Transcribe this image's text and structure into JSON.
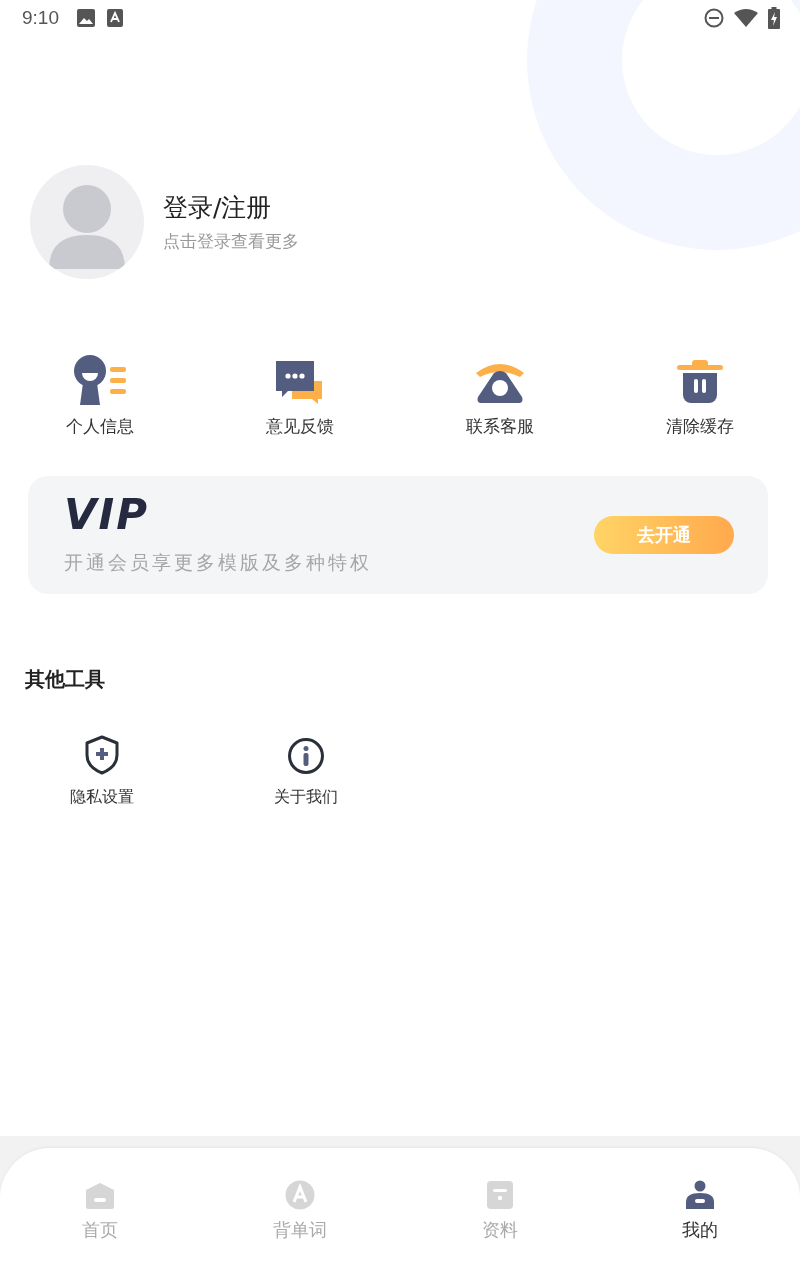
{
  "status_bar": {
    "time": "9:10"
  },
  "profile": {
    "title": "登录/注册",
    "subtitle": "点击登录查看更多"
  },
  "quick_actions": [
    {
      "kind": "profile",
      "label": "个人信息"
    },
    {
      "kind": "feedback",
      "label": "意见反馈"
    },
    {
      "kind": "phone",
      "label": "联系客服"
    },
    {
      "kind": "trash",
      "label": "清除缓存"
    }
  ],
  "vip_card": {
    "logo": "VIP",
    "description": "开通会员享更多模版及多种特权",
    "button": "去开通"
  },
  "other_tools": {
    "title": "其他工具",
    "items": [
      {
        "kind": "shield",
        "label": "隐私设置"
      },
      {
        "kind": "info",
        "label": "关于我们"
      }
    ]
  },
  "tab_bar": [
    {
      "kind": "home",
      "label": "首页",
      "selected": false
    },
    {
      "kind": "words",
      "label": "背单词",
      "selected": false
    },
    {
      "kind": "docs",
      "label": "资料",
      "selected": false
    },
    {
      "kind": "me",
      "label": "我的",
      "selected": true
    }
  ]
}
